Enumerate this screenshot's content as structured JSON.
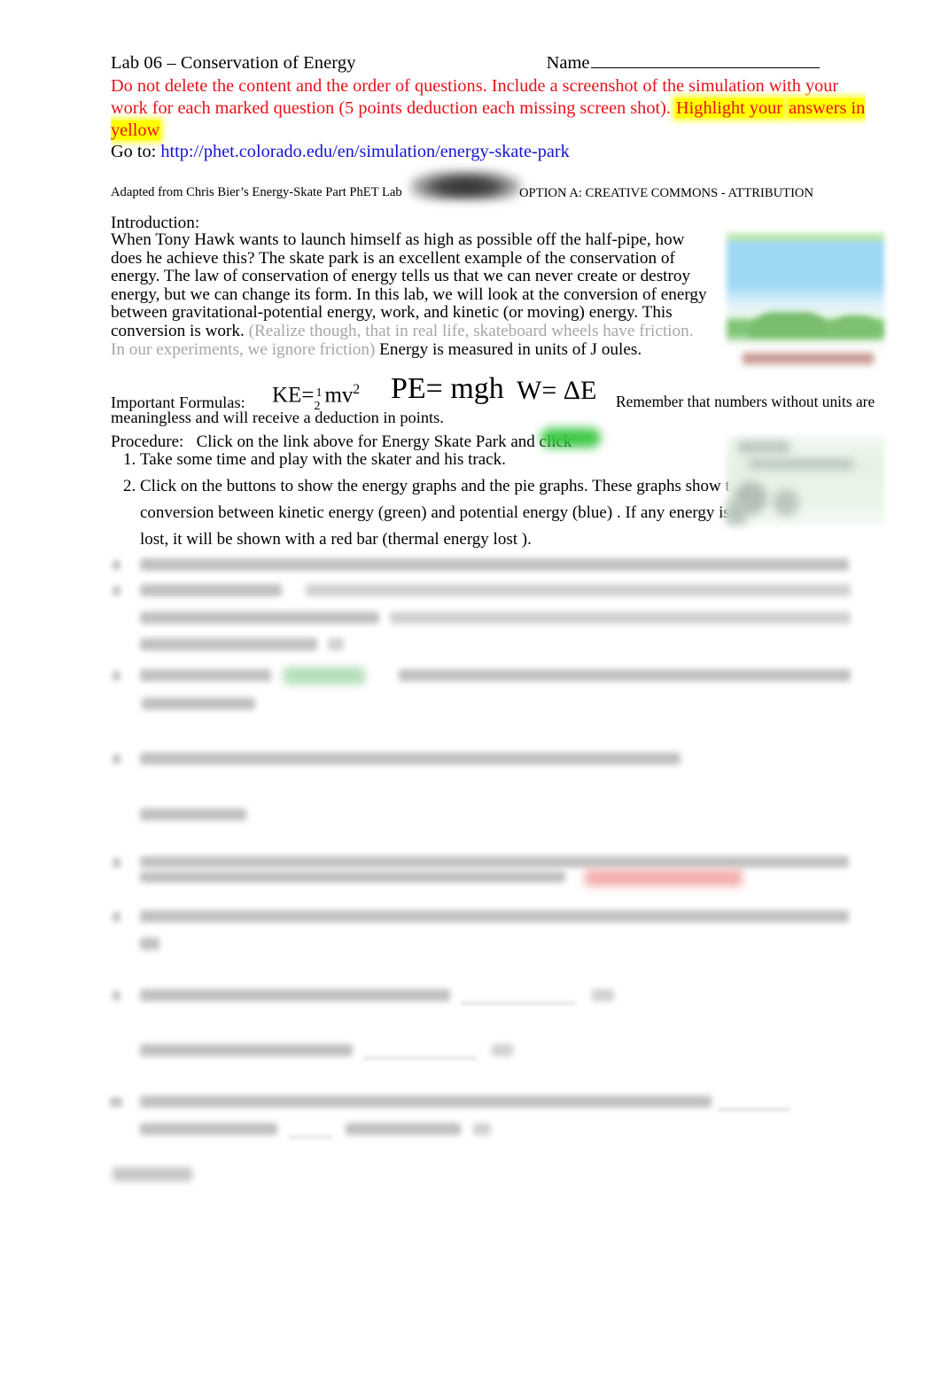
{
  "document": {
    "title": "Lab 06 – Conservation of Energy",
    "name_label": "Name",
    "name_value": ""
  },
  "notice": {
    "line1": "Do not delete the content and the order of questions. Include a screenshot of the simulation with your",
    "line2": "work for each marked question (5 points deduction each missing screen shot).",
    "highlight1": "Highlight your",
    "highlight2": "answers in yellow",
    "color": "#e8111a",
    "highlight_color": "#ffff00"
  },
  "goto": {
    "label": "Go to:",
    "url": "http://phet.colorado.edu/en/simulation/energy-skate-park",
    "link_color": "#1414cf"
  },
  "attribution": {
    "adapted": "Adapted from Chris Bier’s Energy-Skate Part PhET Lab",
    "badge": "creative-commons-badge",
    "option": "OPTION A: CREATIVE COMMONS - ATTRIBUTION"
  },
  "introduction": {
    "label": "Introduction:",
    "text_part1": "When Tony Hawk wants to launch himself as high as possible off the half-pipe, how does he achieve this?  The skate park is an excellent example of the conservation of energy.  The law of conservation of energy tells us that we can never create or destroy energy, but we can change its form.  In this lab, we will look at the conversion of energy between gravitational-potential energy, work, and kinetic (or moving) energy.   This conversion is work.  ",
    "text_grey": "(Realize though, that in real life, skateboard wheels have friction.  In our experiments, we ignore friction)",
    "text_part2": " Energy is measured in units of J oules.",
    "grey_color": "#a6a6a6"
  },
  "formulas": {
    "label": "Important Formulas:",
    "ke": {
      "lhs": "KE=",
      "num": "1",
      "den": "2",
      "rhs": "mv",
      "exp": "2"
    },
    "pe": "PE= mgh",
    "work": "W=  ΔE",
    "remember": "Remember that numbers without units are meaningless and will receive a deduction in points."
  },
  "procedure": {
    "label": "Procedure:",
    "intro": "Click on the link above for Energy Skate Park and click",
    "button_marker": "green-highlight",
    "steps": [
      "Take some time and play with the skater and his track.",
      "Click on the buttons to show the energy graphs and the pie graphs.  These graphs show the conversion between kinetic energy (green)  and potential energy (blue) .  If any energy is lost, it will be shown with a red bar (thermal energy lost )."
    ]
  },
  "thumbnails": [
    {
      "name": "energy-skate-park-simulation-thumbnail",
      "caption": ""
    },
    {
      "name": "energy-graph-thumbnail",
      "caption": ""
    }
  ],
  "redacted": {
    "note": "Remaining questions 3–10 and page footer are blurred and illegible in the source image.",
    "items": [
      {
        "id": "q3",
        "lines": 1
      },
      {
        "id": "q4",
        "lines": 3
      },
      {
        "id": "q5",
        "lines": 2
      },
      {
        "id": "q6",
        "lines": 1
      },
      {
        "id": "q6-answer",
        "lines": 1
      },
      {
        "id": "q7",
        "lines": 2
      },
      {
        "id": "q8",
        "lines": 2
      },
      {
        "id": "q9a",
        "lines": 1
      },
      {
        "id": "q9b",
        "lines": 1
      },
      {
        "id": "q10",
        "lines": 2
      }
    ],
    "footer": "page-number"
  }
}
